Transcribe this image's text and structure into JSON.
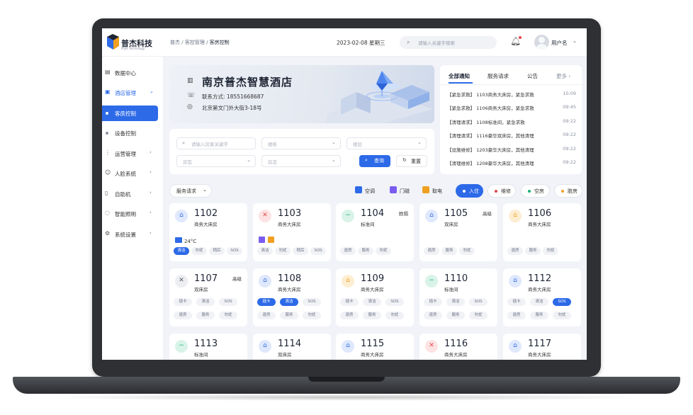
{
  "brand": {
    "name": "普杰科技",
    "subtitle": "Pujie Technology"
  },
  "breadcrumb": [
    "普杰",
    "客控管理",
    "客房控制"
  ],
  "date": "2023-02-08 星期三",
  "search": {
    "placeholder": "请输入关键字搜索"
  },
  "user": {
    "name": "用户名"
  },
  "sidebar": {
    "items": [
      {
        "label": "数据中心",
        "icon": "chart-icon"
      },
      {
        "label": "酒店管理",
        "icon": "hotel-icon",
        "state": "open"
      },
      {
        "label": "客房控制",
        "state": "active"
      },
      {
        "label": "设备控制"
      },
      {
        "label": "运营管理",
        "icon": "operations-icon"
      },
      {
        "label": "人脸系统",
        "icon": "face-icon"
      },
      {
        "label": "自助机",
        "icon": "kiosk-icon"
      },
      {
        "label": "智能照明",
        "icon": "light-bulb-icon"
      },
      {
        "label": "系统设置",
        "icon": "gear-icon"
      }
    ]
  },
  "banner": {
    "hotel_name": "南京普杰智慧酒店",
    "phone": "联系方式: 18551668687",
    "address": "北京第文门外大街3-18号"
  },
  "filters": {
    "keyword_placeholder": "请输入房客关键字",
    "building_placeholder": "楼栋",
    "floor_placeholder": "楼层",
    "type_placeholder": "房型",
    "status_placeholder": "房态",
    "query_label": "查询",
    "reset_label": "重置"
  },
  "notices": {
    "tabs": [
      "全部通知",
      "服务请求",
      "公告",
      "更多"
    ],
    "rows": [
      {
        "text": "【紧急求救】 1103商务大床房，紧急求救",
        "time": "10:09"
      },
      {
        "text": "【紧急求救】 1106商务大床房，紧急求救",
        "time": "09:45"
      },
      {
        "text": "【清理请求】 1108标准间，紧急求救",
        "time": "09:22"
      },
      {
        "text": "【清理请求】 1116豪华双床房，其他清理",
        "time": "09:22"
      },
      {
        "text": "【设施维修】 1203豪华大床房，其他清理",
        "time": "09:22"
      },
      {
        "text": "【清理维修】 1208豪华大床房，其他清理",
        "time": "09:22"
      }
    ]
  },
  "toolbar": {
    "service_select": "服务请求",
    "legend": [
      {
        "label": "空调",
        "color": "#2d6ae8"
      },
      {
        "label": "门磁",
        "color": "#7b5cf0"
      },
      {
        "label": "取电",
        "color": "#f0a020"
      }
    ],
    "status_pills": [
      {
        "label": "入住",
        "color": "#2d6ae8",
        "active": true
      },
      {
        "label": "维修",
        "color": "#e5484d",
        "active": false
      },
      {
        "label": "空房",
        "color": "#19b27a",
        "active": false
      },
      {
        "label": "脏房",
        "color": "#f0a020",
        "active": false
      }
    ]
  },
  "rooms": [
    {
      "number": "1102",
      "type": "商务大床房",
      "kind": "occupied",
      "icon": "house-icon",
      "extra": "24°C",
      "chips": [
        {
          "label": "清洁",
          "on": true
        },
        {
          "label": "勿扰"
        },
        {
          "label": "稍后"
        },
        {
          "label": "SOS"
        }
      ]
    },
    {
      "number": "1103",
      "type": "商务大床房",
      "kind": "repair",
      "icon": "tools-icon",
      "extra": "",
      "chips": [
        {
          "label": "清洁"
        },
        {
          "label": "勿扰"
        },
        {
          "label": "稍后"
        },
        {
          "label": "SOS"
        }
      ]
    },
    {
      "number": "1104",
      "type": "标准间",
      "kind": "vacant",
      "icon": "minus-icon",
      "badge": "欧隔",
      "extra": "",
      "chips": [
        {
          "label": "退房"
        },
        {
          "label": "服务"
        },
        {
          "label": "勿扰"
        }
      ]
    },
    {
      "number": "1105",
      "type": "双床房",
      "kind": "occupied",
      "icon": "house-icon",
      "badge": "高级",
      "extra": "",
      "chips": [
        {
          "label": "退房"
        },
        {
          "label": "服务"
        },
        {
          "label": "勿扰"
        }
      ]
    },
    {
      "number": "1106",
      "type": "商务大床房",
      "kind": "dirty",
      "icon": "broom-icon",
      "extra": "",
      "chips": [
        {
          "label": "退房"
        },
        {
          "label": "服务"
        },
        {
          "label": "勿扰"
        }
      ]
    },
    {
      "number": "1107",
      "type": "双床房",
      "kind": "repair-grey",
      "icon": "tools-icon",
      "badge": "高级",
      "chips": [
        {
          "label": "插卡"
        },
        {
          "label": "清洁"
        },
        {
          "label": "SOS"
        },
        {
          "label": "退房"
        },
        {
          "label": "服务"
        },
        {
          "label": "勿扰"
        }
      ]
    },
    {
      "number": "1108",
      "type": "商务大床房",
      "kind": "occupied",
      "icon": "house-icon",
      "chips": [
        {
          "label": "插卡",
          "on": true
        },
        {
          "label": "清洁",
          "on": true
        },
        {
          "label": "SOS"
        },
        {
          "label": "退房"
        },
        {
          "label": "服务"
        },
        {
          "label": "勿扰"
        }
      ]
    },
    {
      "number": "1109",
      "type": "商务大床房",
      "kind": "dirty",
      "icon": "broom-icon",
      "chips": [
        {
          "label": "插卡"
        },
        {
          "label": "清洁"
        },
        {
          "label": "SOS"
        },
        {
          "label": "退房"
        },
        {
          "label": "服务"
        },
        {
          "label": "勿扰"
        }
      ]
    },
    {
      "number": "1110",
      "type": "标准间",
      "kind": "vacant",
      "icon": "minus-icon",
      "chips": [
        {
          "label": "插卡"
        },
        {
          "label": "清洁"
        },
        {
          "label": "SOS"
        },
        {
          "label": "退房"
        },
        {
          "label": "服务"
        },
        {
          "label": "勿扰"
        }
      ]
    },
    {
      "number": "1112",
      "type": "商务大床房",
      "kind": "occupied",
      "icon": "house-icon",
      "chips": [
        {
          "label": "插卡"
        },
        {
          "label": "清洁"
        },
        {
          "label": "SOS",
          "on": true
        },
        {
          "label": "退房"
        },
        {
          "label": "服务"
        },
        {
          "label": "勿扰"
        }
      ]
    },
    {
      "number": "1113",
      "type": "标准间",
      "kind": "vacant",
      "icon": "minus-icon",
      "chips": []
    },
    {
      "number": "1114",
      "type": "双床房",
      "kind": "occupied",
      "icon": "house-icon",
      "chips": []
    },
    {
      "number": "1115",
      "type": "商务大床房",
      "kind": "occupied",
      "icon": "house-icon",
      "chips": []
    },
    {
      "number": "1116",
      "type": "商务大床房",
      "kind": "repair",
      "icon": "tools-icon",
      "chips": []
    },
    {
      "number": "1117",
      "type": "商务大床房",
      "kind": "occupied",
      "icon": "house-icon",
      "chips": []
    }
  ],
  "colors": {
    "accent": "#2d6ae8",
    "repair": "#e5484d",
    "vacant": "#19b27a",
    "dirty": "#f0a020"
  }
}
